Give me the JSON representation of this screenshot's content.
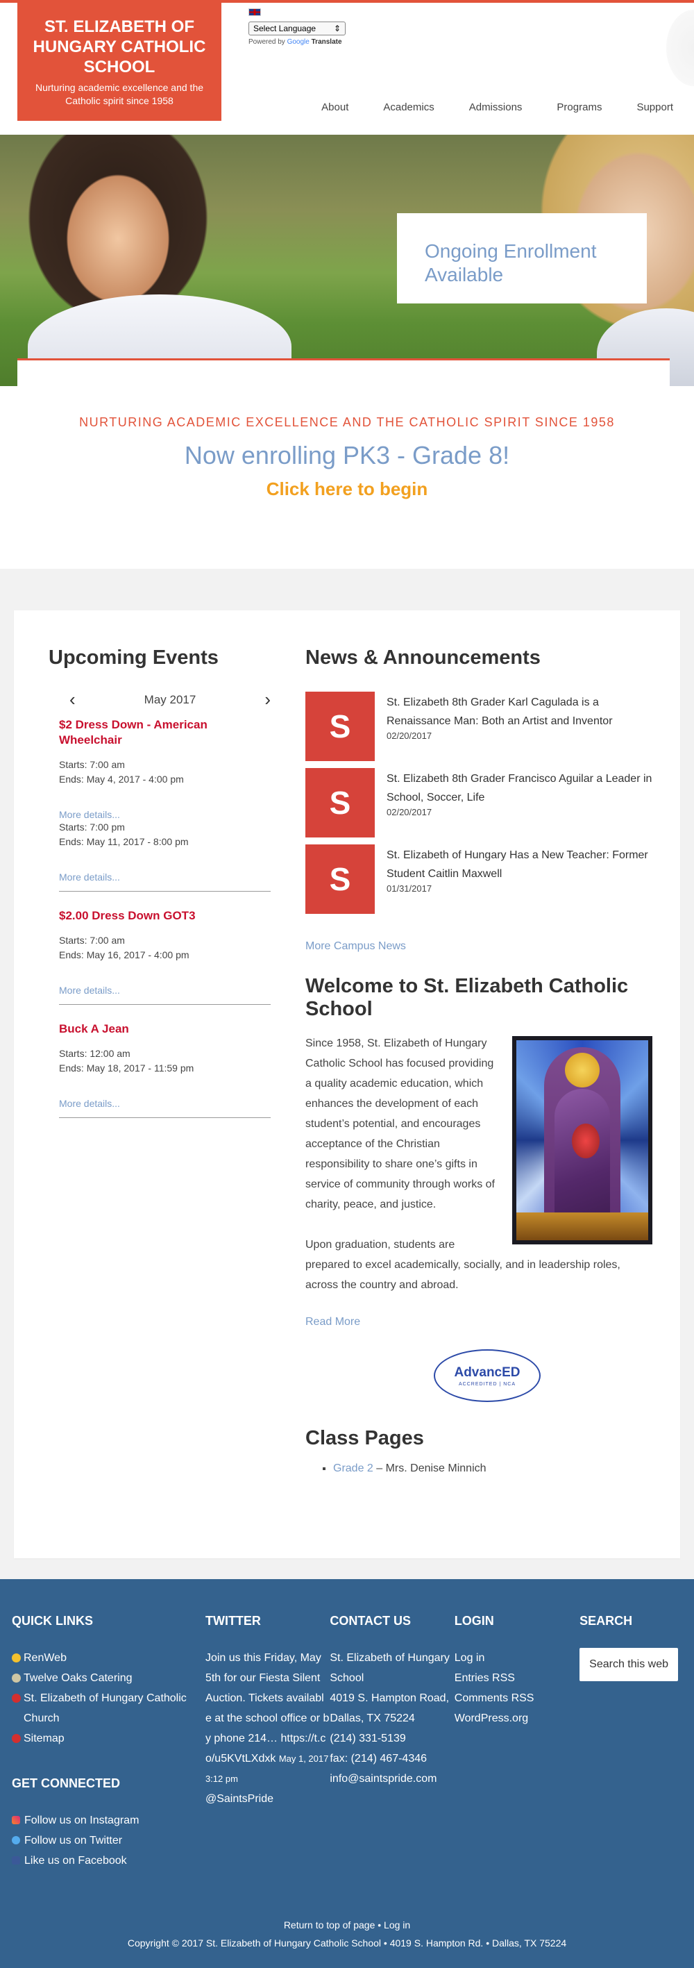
{
  "header": {
    "school_name": "St. Elizabeth of Hungary Catholic School",
    "tagline": "Nurturing academic excellence and the Catholic spirit since 1958",
    "language_select": "Select Language",
    "powered_by": "Powered by",
    "google": "Google",
    "translate": "Translate",
    "nav": [
      "About",
      "Academics",
      "Admissions",
      "Programs",
      "Support"
    ]
  },
  "hero": {
    "card_text": "Ongoing Enrollment Available"
  },
  "intro": {
    "tagline": "Nurturing academic excellence and the Catholic spirit since 1958",
    "headline": "Now enrolling PK3 - Grade 8!",
    "cta": "Click here to begin"
  },
  "events": {
    "heading": "Upcoming Events",
    "month": "May 2017",
    "items": [
      {
        "title": "$2 Dress Down - American Wheelchair",
        "starts": "Starts: 7:00 am",
        "ends": "Ends: May 4, 2017 - 4:00 pm",
        "more": "More details...",
        "starts2": "Starts: 7:00 pm",
        "ends2": "Ends: May 11, 2017 - 8:00 pm",
        "more2": "More details..."
      },
      {
        "title": "$2.00 Dress Down GOT3",
        "starts": "Starts: 7:00 am",
        "ends": "Ends: May 16, 2017 - 4:00 pm",
        "more": "More details..."
      },
      {
        "title": "Buck A Jean",
        "starts": "Starts: 12:00 am",
        "ends": "Ends: May 18, 2017 - 11:59 pm",
        "more": "More details..."
      }
    ]
  },
  "news": {
    "heading": "News & Announcements",
    "items": [
      {
        "thumb": "S",
        "title": "St. Elizabeth 8th Grader Karl Cagulada is a Renaissance Man: Both an Artist and Inventor",
        "date": "02/20/2017"
      },
      {
        "thumb": "S",
        "title": "St. Elizabeth 8th Grader Francisco Aguilar a Leader in School, Soccer, Life",
        "date": "02/20/2017"
      },
      {
        "thumb": "S",
        "title": "St. Elizabeth of Hungary Has a New Teacher: Former Student Caitlin Maxwell",
        "date": "01/31/2017"
      }
    ],
    "more": "More Campus News"
  },
  "welcome": {
    "heading": "Welcome to St. Elizabeth Catholic School",
    "p1": "Since 1958, St. Elizabeth of Hungary Catholic School has focused providing a quality academic education, which enhances the development of each student’s potential, and encourages acceptance of the Christian responsibility to share one’s gifts in service of community through works of charity, peace, and justice.",
    "p2": "Upon graduation, students are prepared to excel academically, socially, and in leadership roles, across the country and abroad.",
    "read_more": "Read More",
    "badge_name": "AdvancED",
    "badge_sub": "ACCREDITED | NCA"
  },
  "class_pages": {
    "heading": "Class Pages",
    "items": [
      {
        "link": "Grade 2",
        "teacher": " – Mrs. Denise Minnich"
      }
    ]
  },
  "footer": {
    "quick_links": {
      "heading": "Quick Links",
      "items": [
        "RenWeb",
        "Twelve Oaks Catering",
        "St. Elizabeth of Hungary Catholic Church",
        "Sitemap"
      ]
    },
    "get_connected": {
      "heading": "Get Connected",
      "items": [
        "Follow us on Instagram",
        "Follow us on Twitter",
        "Like us on Facebook"
      ]
    },
    "twitter": {
      "heading": "Twitter",
      "tweet": "Join us this Friday, May 5th for our Fiesta Silent Auction. Tickets available at the school office or by phone 214… https://t.co/u5KVtLXdxk",
      "time": "May 1, 2017 3:12 pm",
      "handle": "@SaintsPride"
    },
    "contact": {
      "heading": "Contact Us",
      "name": "St. Elizabeth of Hungary School",
      "address": "4019 S. Hampton Road, Dallas, TX 75224",
      "phone": "(214) 331-5139",
      "fax": "fax: (214) 467-4346",
      "email": "info@saintspride.com"
    },
    "login": {
      "heading": "Login",
      "items": [
        "Log in",
        "Entries RSS",
        "Comments RSS",
        "WordPress.org"
      ]
    },
    "search": {
      "heading": "Search",
      "placeholder": "Search this web"
    },
    "bottom_line1": "Return to top of page • Log in",
    "bottom_line2": "Copyright © 2017 St. Elizabeth of Hungary Catholic School • 4019 S. Hampton Rd. • Dallas, TX 75224"
  }
}
